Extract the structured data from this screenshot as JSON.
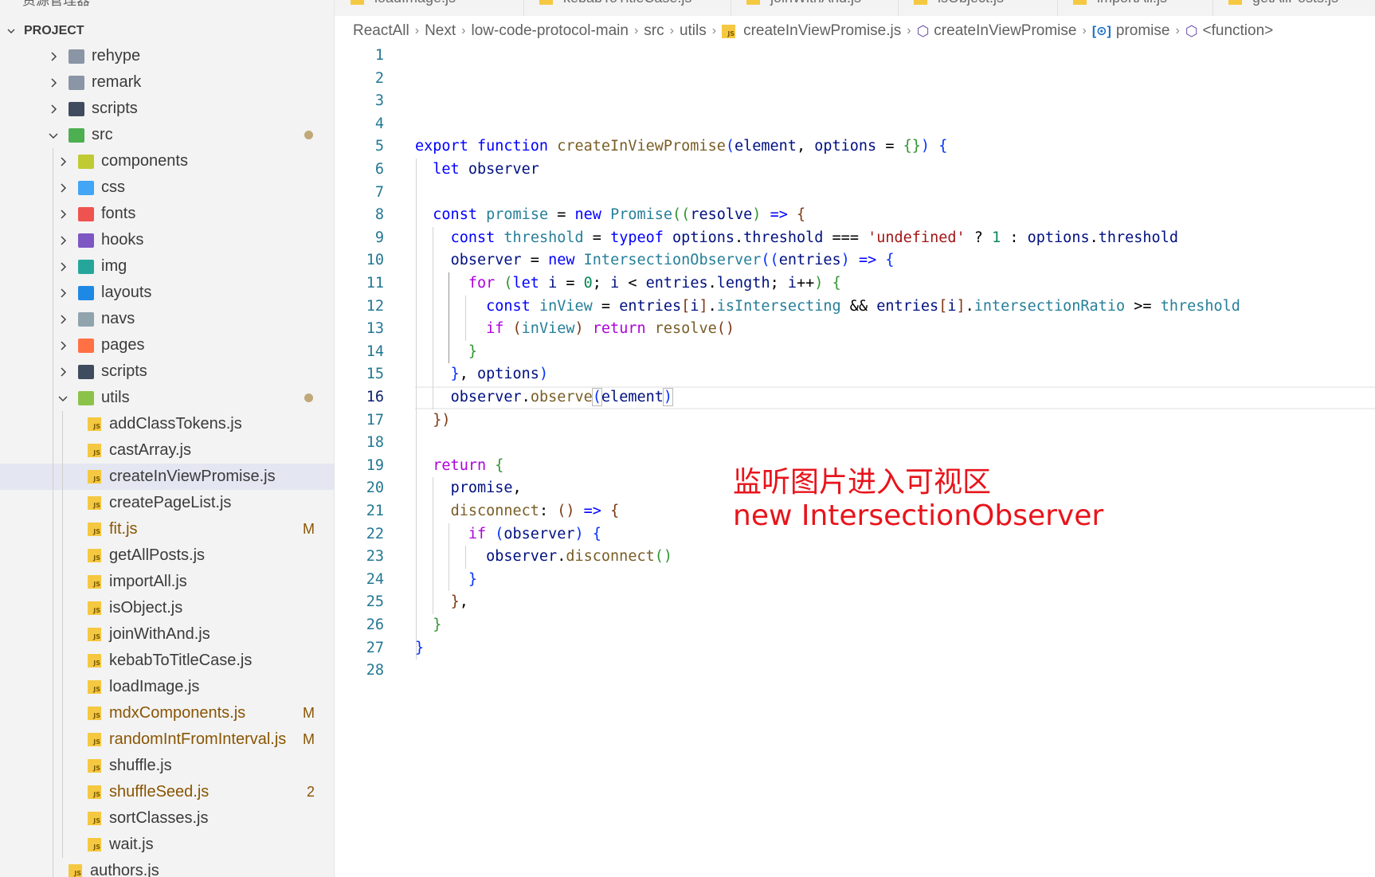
{
  "sidebar": {
    "top_cut_label": "资源管理器",
    "project_title": "PROJECT",
    "items": [
      {
        "label": "rehype",
        "kind": "folder",
        "color": "#8a95a5",
        "open": false
      },
      {
        "label": "remark",
        "kind": "folder",
        "color": "#8a95a5",
        "open": false
      },
      {
        "label": "scripts",
        "kind": "folder",
        "color": "#3f4b5e",
        "open": false
      },
      {
        "label": "src",
        "kind": "folder-open",
        "color": "#4caf50",
        "open": true,
        "dot": true
      },
      {
        "label": "components",
        "kind": "folder",
        "color": "#c0ca33",
        "open": false
      },
      {
        "label": "css",
        "kind": "folder",
        "color": "#42a5f5",
        "open": false
      },
      {
        "label": "fonts",
        "kind": "folder",
        "color": "#ef5350",
        "open": false
      },
      {
        "label": "hooks",
        "kind": "folder",
        "color": "#7e57c2",
        "open": false
      },
      {
        "label": "img",
        "kind": "folder",
        "color": "#26a69a",
        "open": false
      },
      {
        "label": "layouts",
        "kind": "folder",
        "color": "#1e88e5",
        "open": false
      },
      {
        "label": "navs",
        "kind": "folder",
        "color": "#90a4ae",
        "open": false
      },
      {
        "label": "pages",
        "kind": "folder",
        "color": "#ff7043",
        "open": false
      },
      {
        "label": "scripts",
        "kind": "folder",
        "color": "#3f4b5e",
        "open": false
      },
      {
        "label": "utils",
        "kind": "folder-open",
        "color": "#8bc34a",
        "open": true,
        "dot": true
      },
      {
        "label": "addClassTokens.js",
        "kind": "js"
      },
      {
        "label": "castArray.js",
        "kind": "js"
      },
      {
        "label": "createInViewPromise.js",
        "kind": "js",
        "selected": true
      },
      {
        "label": "createPageList.js",
        "kind": "js"
      },
      {
        "label": "fit.js",
        "kind": "js",
        "badge": "M"
      },
      {
        "label": "getAllPosts.js",
        "kind": "js"
      },
      {
        "label": "importAll.js",
        "kind": "js"
      },
      {
        "label": "isObject.js",
        "kind": "js"
      },
      {
        "label": "joinWithAnd.js",
        "kind": "js"
      },
      {
        "label": "kebabToTitleCase.js",
        "kind": "js"
      },
      {
        "label": "loadImage.js",
        "kind": "js"
      },
      {
        "label": "mdxComponents.js",
        "kind": "js",
        "badge": "M"
      },
      {
        "label": "randomIntFromInterval.js",
        "kind": "js",
        "badge": "M"
      },
      {
        "label": "shuffle.js",
        "kind": "js"
      },
      {
        "label": "shuffleSeed.js",
        "kind": "js",
        "badge": "2"
      },
      {
        "label": "sortClasses.js",
        "kind": "js"
      },
      {
        "label": "wait.js",
        "kind": "js"
      },
      {
        "label": "authors.js",
        "kind": "js"
      }
    ]
  },
  "tabs": [
    "loadImage.js",
    "kebabToTitleCase.js",
    "joinWithAnd.js",
    "isObject.js",
    "importAll.js",
    "getAllPosts.js"
  ],
  "breadcrumb": [
    "ReactAll",
    "Next",
    "low-code-protocol-main",
    "src",
    "utils",
    "createInViewPromise.js",
    "createInViewPromise",
    "promise",
    "<function>"
  ],
  "editor": {
    "current_line": 16,
    "lines": [
      [],
      [],
      [],
      [],
      [
        [
          "k",
          "export"
        ],
        [
          "p",
          " "
        ],
        [
          "k",
          "function"
        ],
        [
          "p",
          " "
        ],
        [
          "f",
          "createInViewPromise"
        ],
        [
          "b1",
          "("
        ],
        [
          "v",
          "element"
        ],
        [
          "p",
          ", "
        ],
        [
          "v",
          "options"
        ],
        [
          "p",
          " = "
        ],
        [
          "b2",
          "{}"
        ],
        [
          "b1",
          ")"
        ],
        [
          "p",
          " "
        ],
        [
          "b1",
          "{"
        ]
      ],
      [
        [
          "p",
          "  "
        ],
        [
          "k",
          "let"
        ],
        [
          "p",
          " "
        ],
        [
          "v",
          "observer"
        ]
      ],
      [],
      [
        [
          "p",
          "  "
        ],
        [
          "k",
          "const"
        ],
        [
          "p",
          " "
        ],
        [
          "t",
          "promise"
        ],
        [
          "p",
          " = "
        ],
        [
          "k",
          "new"
        ],
        [
          "p",
          " "
        ],
        [
          "t",
          "Promise"
        ],
        [
          "b2",
          "(("
        ],
        [
          "v",
          "resolve"
        ],
        [
          "b2",
          ")"
        ],
        [
          "p",
          " "
        ],
        [
          "k",
          "=>"
        ],
        [
          "p",
          " "
        ],
        [
          "b3",
          "{"
        ]
      ],
      [
        [
          "p",
          "    "
        ],
        [
          "k",
          "const"
        ],
        [
          "p",
          " "
        ],
        [
          "t",
          "threshold"
        ],
        [
          "p",
          " = "
        ],
        [
          "k",
          "typeof"
        ],
        [
          "p",
          " "
        ],
        [
          "v",
          "options"
        ],
        [
          "p",
          "."
        ],
        [
          "v",
          "threshold"
        ],
        [
          "p",
          " === "
        ],
        [
          "s",
          "'undefined'"
        ],
        [
          "p",
          " ? "
        ],
        [
          "n",
          "1"
        ],
        [
          "p",
          " : "
        ],
        [
          "v",
          "options"
        ],
        [
          "p",
          "."
        ],
        [
          "v",
          "threshold"
        ]
      ],
      [
        [
          "p",
          "    "
        ],
        [
          "v",
          "observer"
        ],
        [
          "p",
          " = "
        ],
        [
          "k",
          "new"
        ],
        [
          "p",
          " "
        ],
        [
          "t",
          "IntersectionObserver"
        ],
        [
          "b1",
          "(("
        ],
        [
          "v",
          "entries"
        ],
        [
          "b1",
          ")"
        ],
        [
          "p",
          " "
        ],
        [
          "k",
          "=>"
        ],
        [
          "p",
          " "
        ],
        [
          "b1",
          "{"
        ]
      ],
      [
        [
          "p",
          "      "
        ],
        [
          "c",
          "for"
        ],
        [
          "p",
          " "
        ],
        [
          "b2",
          "("
        ],
        [
          "k",
          "let"
        ],
        [
          "p",
          " "
        ],
        [
          "v",
          "i"
        ],
        [
          "p",
          " = "
        ],
        [
          "n",
          "0"
        ],
        [
          "p",
          "; "
        ],
        [
          "v",
          "i"
        ],
        [
          "p",
          " < "
        ],
        [
          "v",
          "entries"
        ],
        [
          "p",
          "."
        ],
        [
          "v",
          "length"
        ],
        [
          "p",
          "; "
        ],
        [
          "v",
          "i"
        ],
        [
          "p",
          "++"
        ],
        [
          "b2",
          ")"
        ],
        [
          "p",
          " "
        ],
        [
          "b2",
          "{"
        ]
      ],
      [
        [
          "p",
          "        "
        ],
        [
          "k",
          "const"
        ],
        [
          "p",
          " "
        ],
        [
          "t",
          "inView"
        ],
        [
          "p",
          " = "
        ],
        [
          "v",
          "entries"
        ],
        [
          "b3",
          "["
        ],
        [
          "v",
          "i"
        ],
        [
          "b3",
          "]"
        ],
        [
          "p",
          "."
        ],
        [
          "t",
          "isIntersecting"
        ],
        [
          "p",
          " && "
        ],
        [
          "v",
          "entries"
        ],
        [
          "b3",
          "["
        ],
        [
          "v",
          "i"
        ],
        [
          "b3",
          "]"
        ],
        [
          "p",
          "."
        ],
        [
          "t",
          "intersectionRatio"
        ],
        [
          "p",
          " >= "
        ],
        [
          "t",
          "threshold"
        ]
      ],
      [
        [
          "p",
          "        "
        ],
        [
          "c",
          "if"
        ],
        [
          "p",
          " "
        ],
        [
          "b3",
          "("
        ],
        [
          "t",
          "inView"
        ],
        [
          "b3",
          ")"
        ],
        [
          "p",
          " "
        ],
        [
          "c",
          "return"
        ],
        [
          "p",
          " "
        ],
        [
          "f",
          "resolve"
        ],
        [
          "b3",
          "()"
        ]
      ],
      [
        [
          "p",
          "      "
        ],
        [
          "b2",
          "}"
        ]
      ],
      [
        [
          "p",
          "    "
        ],
        [
          "b1",
          "}"
        ],
        [
          "p",
          ", "
        ],
        [
          "v",
          "options"
        ],
        [
          "b1",
          ")"
        ]
      ],
      [
        [
          "p",
          "    "
        ],
        [
          "v",
          "observer"
        ],
        [
          "p",
          "."
        ],
        [
          "f",
          "observe"
        ],
        [
          "b1m",
          "("
        ],
        [
          "v",
          "element"
        ],
        [
          "b1m",
          ")"
        ]
      ],
      [
        [
          "p",
          "  "
        ],
        [
          "b3",
          "})"
        ]
      ],
      [],
      [
        [
          "p",
          "  "
        ],
        [
          "c",
          "return"
        ],
        [
          "p",
          " "
        ],
        [
          "b2",
          "{"
        ]
      ],
      [
        [
          "p",
          "    "
        ],
        [
          "v",
          "promise"
        ],
        [
          "p",
          ","
        ]
      ],
      [
        [
          "p",
          "    "
        ],
        [
          "f",
          "disconnect"
        ],
        [
          "p",
          ": "
        ],
        [
          "b3",
          "()"
        ],
        [
          "p",
          " "
        ],
        [
          "k",
          "=>"
        ],
        [
          "p",
          " "
        ],
        [
          "b3",
          "{"
        ]
      ],
      [
        [
          "p",
          "      "
        ],
        [
          "c",
          "if"
        ],
        [
          "p",
          " "
        ],
        [
          "b1",
          "("
        ],
        [
          "v",
          "observer"
        ],
        [
          "b1",
          ")"
        ],
        [
          "p",
          " "
        ],
        [
          "b1",
          "{"
        ]
      ],
      [
        [
          "p",
          "        "
        ],
        [
          "v",
          "observer"
        ],
        [
          "p",
          "."
        ],
        [
          "f",
          "disconnect"
        ],
        [
          "b2",
          "()"
        ]
      ],
      [
        [
          "p",
          "      "
        ],
        [
          "b1",
          "}"
        ]
      ],
      [
        [
          "p",
          "    "
        ],
        [
          "b3",
          "}"
        ],
        [
          "p",
          ","
        ]
      ],
      [
        [
          "p",
          "  "
        ],
        [
          "b2",
          "}"
        ]
      ],
      [
        [
          "b1",
          "}"
        ]
      ],
      []
    ]
  },
  "annotation": {
    "line1": "监听图片进入可视区",
    "line2": "new IntersectionObserver"
  }
}
